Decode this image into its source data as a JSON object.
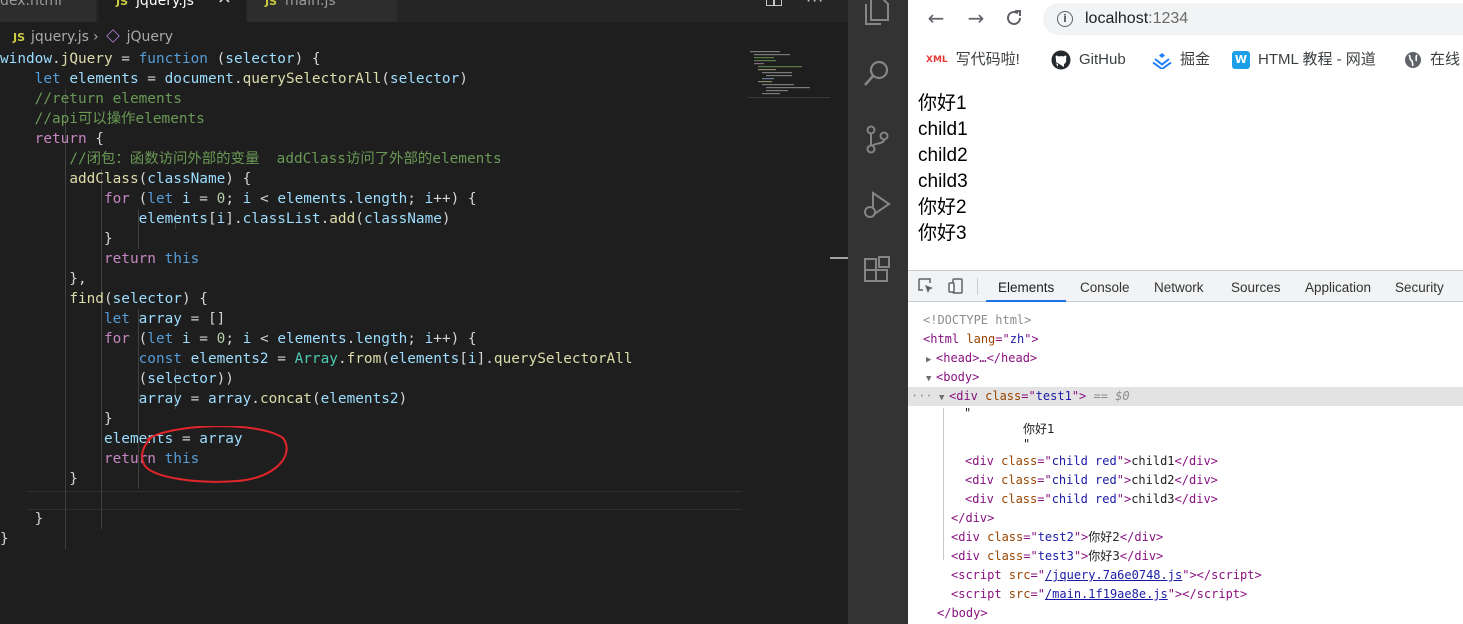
{
  "editor": {
    "tabs": [
      {
        "label": "dex.html",
        "active": false
      },
      {
        "label": "jquery.js",
        "active": true
      },
      {
        "label": "main.js",
        "active": false
      }
    ],
    "tab_js_badge": "JS",
    "close_glyph": "×",
    "breadcrumb": {
      "file": "jquery.js",
      "symbol": "jQuery"
    },
    "lines": [
      [
        [
          "var",
          "window"
        ],
        [
          "br",
          "."
        ],
        [
          "fn",
          "jQuery"
        ],
        [
          "br",
          " = "
        ],
        [
          "kw",
          "function"
        ],
        [
          "br",
          " ("
        ],
        [
          "var",
          "selector"
        ],
        [
          "br",
          ") {"
        ]
      ],
      [
        [
          "br",
          "    "
        ],
        [
          "kw",
          "let"
        ],
        [
          "br",
          " "
        ],
        [
          "var",
          "elements"
        ],
        [
          "br",
          " = "
        ],
        [
          "var",
          "document"
        ],
        [
          "br",
          "."
        ],
        [
          "fn",
          "querySelectorAll"
        ],
        [
          "br",
          "("
        ],
        [
          "var",
          "selector"
        ],
        [
          "br",
          ")"
        ]
      ],
      [
        [
          "br",
          "    "
        ],
        [
          "cm",
          "//return elements"
        ]
      ],
      [
        [
          "br",
          "    "
        ],
        [
          "cm",
          "//api可以操作elements"
        ]
      ],
      [
        [
          "br",
          "    "
        ],
        [
          "ctl",
          "return"
        ],
        [
          "br",
          " {"
        ]
      ],
      [
        [
          "br",
          "        "
        ],
        [
          "cm",
          "//闭包：函数访问外部的变量  addClass访问了外部的elements"
        ]
      ],
      [
        [
          "br",
          "        "
        ],
        [
          "fn",
          "addClass"
        ],
        [
          "br",
          "("
        ],
        [
          "var",
          "className"
        ],
        [
          "br",
          ") {"
        ]
      ],
      [
        [
          "br",
          "            "
        ],
        [
          "ctl",
          "for"
        ],
        [
          "br",
          " ("
        ],
        [
          "kw",
          "let"
        ],
        [
          "br",
          " "
        ],
        [
          "var",
          "i"
        ],
        [
          "br",
          " = "
        ],
        [
          "num",
          "0"
        ],
        [
          "br",
          "; "
        ],
        [
          "var",
          "i"
        ],
        [
          "br",
          " < "
        ],
        [
          "var",
          "elements"
        ],
        [
          "br",
          "."
        ],
        [
          "var",
          "length"
        ],
        [
          "br",
          "; "
        ],
        [
          "var",
          "i"
        ],
        [
          "br",
          "++) {"
        ]
      ],
      [
        [
          "br",
          "                "
        ],
        [
          "var",
          "elements"
        ],
        [
          "br",
          "["
        ],
        [
          "var",
          "i"
        ],
        [
          "br",
          "]."
        ],
        [
          "var",
          "classList"
        ],
        [
          "br",
          "."
        ],
        [
          "fn",
          "add"
        ],
        [
          "br",
          "("
        ],
        [
          "var",
          "className"
        ],
        [
          "br",
          ")"
        ]
      ],
      [
        [
          "br",
          "            }"
        ]
      ],
      [
        [
          "br",
          "            "
        ],
        [
          "ctl",
          "return"
        ],
        [
          "br",
          " "
        ],
        [
          "kw",
          "this"
        ]
      ],
      [
        [
          "br",
          "        },"
        ]
      ],
      [
        [
          "br",
          "        "
        ],
        [
          "fn",
          "find"
        ],
        [
          "br",
          "("
        ],
        [
          "var",
          "selector"
        ],
        [
          "br",
          ") {"
        ]
      ],
      [
        [
          "br",
          "            "
        ],
        [
          "kw",
          "let"
        ],
        [
          "br",
          " "
        ],
        [
          "var",
          "array"
        ],
        [
          "br",
          " = []"
        ]
      ],
      [
        [
          "br",
          "            "
        ],
        [
          "ctl",
          "for"
        ],
        [
          "br",
          " ("
        ],
        [
          "kw",
          "let"
        ],
        [
          "br",
          " "
        ],
        [
          "var",
          "i"
        ],
        [
          "br",
          " = "
        ],
        [
          "num",
          "0"
        ],
        [
          "br",
          "; "
        ],
        [
          "var",
          "i"
        ],
        [
          "br",
          " < "
        ],
        [
          "var",
          "elements"
        ],
        [
          "br",
          "."
        ],
        [
          "var",
          "length"
        ],
        [
          "br",
          "; "
        ],
        [
          "var",
          "i"
        ],
        [
          "br",
          "++) {"
        ]
      ],
      [
        [
          "br",
          "                "
        ],
        [
          "kw",
          "const"
        ],
        [
          "br",
          " "
        ],
        [
          "var",
          "elements2"
        ],
        [
          "br",
          " = "
        ],
        [
          "cls",
          "Array"
        ],
        [
          "br",
          "."
        ],
        [
          "fn",
          "from"
        ],
        [
          "br",
          "("
        ],
        [
          "var",
          "elements"
        ],
        [
          "br",
          "["
        ],
        [
          "var",
          "i"
        ],
        [
          "br",
          "]."
        ],
        [
          "fn",
          "querySelectorAll"
        ]
      ],
      [
        [
          "br",
          "                ("
        ],
        [
          "var",
          "selector"
        ],
        [
          "br",
          "))"
        ]
      ],
      [
        [
          "br",
          "                "
        ],
        [
          "var",
          "array"
        ],
        [
          "br",
          " = "
        ],
        [
          "var",
          "array"
        ],
        [
          "br",
          "."
        ],
        [
          "fn",
          "concat"
        ],
        [
          "br",
          "("
        ],
        [
          "var",
          "elements2"
        ],
        [
          "br",
          ")"
        ]
      ],
      [
        [
          "br",
          "            }"
        ]
      ],
      [
        [
          "br",
          "            "
        ],
        [
          "var",
          "elements"
        ],
        [
          "br",
          " = "
        ],
        [
          "var",
          "array"
        ]
      ],
      [
        [
          "br",
          "            "
        ],
        [
          "ctl",
          "return"
        ],
        [
          "br",
          " "
        ],
        [
          "kw",
          "this"
        ]
      ],
      [
        [
          "br",
          "        }"
        ]
      ],
      [
        [
          "br",
          ""
        ]
      ],
      [
        [
          "br",
          "    }"
        ]
      ],
      [
        [
          "br",
          "}"
        ]
      ]
    ]
  },
  "browser": {
    "url_host": "localhost",
    "url_port": ":1234",
    "bookmarks": [
      {
        "label": "写代码啦!",
        "icon": "xml-icon"
      },
      {
        "label": "GitHub",
        "icon": "github-icon"
      },
      {
        "label": "掘金",
        "icon": "juejin-icon"
      },
      {
        "label": "HTML 教程 - 网道",
        "icon": "wangdao-icon"
      },
      {
        "label": "在线",
        "icon": "globe-icon"
      }
    ],
    "page_lines": [
      "你好1",
      "child1",
      "child2",
      "child3",
      "你好2",
      "你好3"
    ]
  },
  "devtools": {
    "tabs": [
      "Elements",
      "Console",
      "Network",
      "Sources",
      "Application",
      "Security"
    ],
    "active_tab": "Elements",
    "dom": {
      "doctype": "<!DOCTYPE html>",
      "html_tag": "html",
      "html_lang": "zh",
      "head_collapsed": "<head>…</head>",
      "body_open": "<body>",
      "test1_class": "test1",
      "selected_marker": "== $0",
      "text_quote": "\"",
      "text_nihao1": "你好1",
      "children": [
        {
          "class": "child red",
          "text": "child1"
        },
        {
          "class": "child red",
          "text": "child2"
        },
        {
          "class": "child red",
          "text": "child3"
        }
      ],
      "div_close": "</div>",
      "test2_class": "test2",
      "test2_text": "你好2",
      "test3_class": "test3",
      "test3_text": "你好3",
      "scripts": [
        "/jquery.7a6e0748.js",
        "/main.1f19ae8e.js"
      ],
      "body_close": "</body>"
    }
  },
  "colors": {
    "editor_bg": "#1e1e1e",
    "keyword": "#569cd6",
    "control": "#c586c0",
    "variable": "#9cdcfe",
    "function": "#dcdcaa",
    "comment": "#6a9955",
    "annotation_circle": "#e0262a",
    "devtools_accent": "#1a73e8"
  }
}
